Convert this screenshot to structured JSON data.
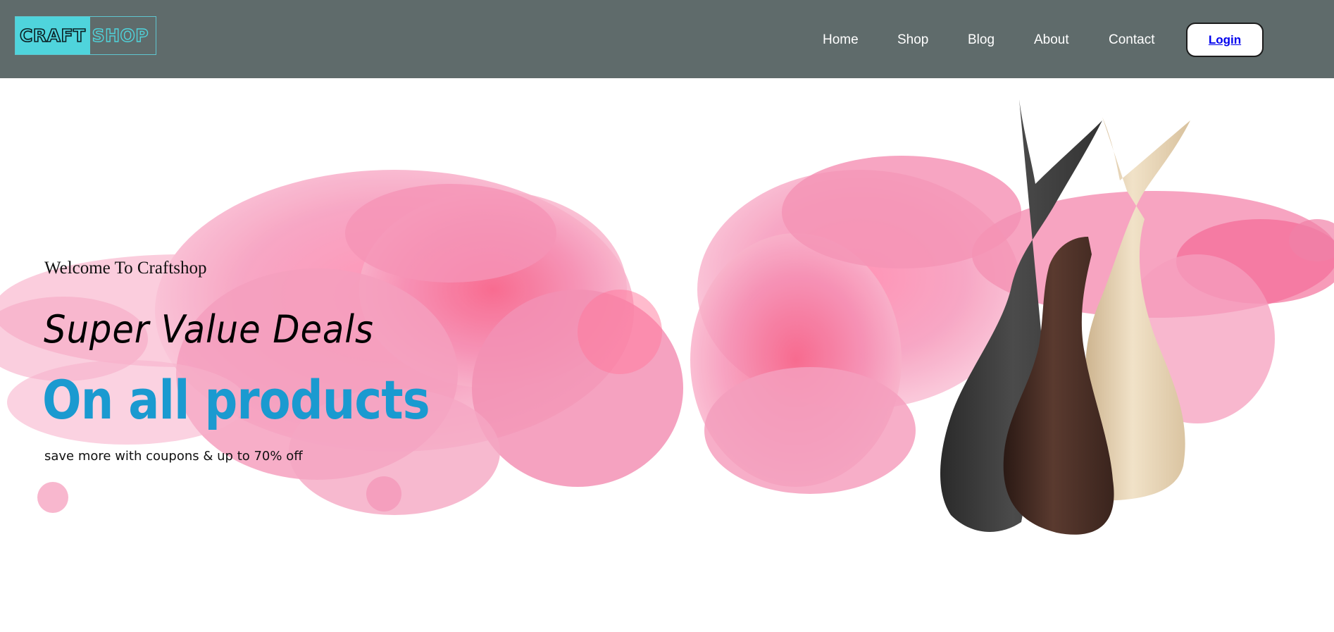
{
  "header": {
    "logo": {
      "part1": "CRAFT",
      "part2": "SHOP"
    },
    "nav": [
      {
        "label": "Home"
      },
      {
        "label": "Shop"
      },
      {
        "label": "Blog"
      },
      {
        "label": "About"
      },
      {
        "label": "Contact"
      }
    ],
    "login_label": "Login"
  },
  "hero": {
    "welcome": "Welcome To Craftshop",
    "headline": "Super Value Deals",
    "subheadline": "On all products",
    "tagline": "save more with coupons & up to 70% off"
  },
  "colors": {
    "header_bg": "#5f6b6b",
    "logo_accent": "#4fd4dc",
    "subheadline": "#1a9ad0",
    "ink_cloud": "#f26d9b"
  }
}
